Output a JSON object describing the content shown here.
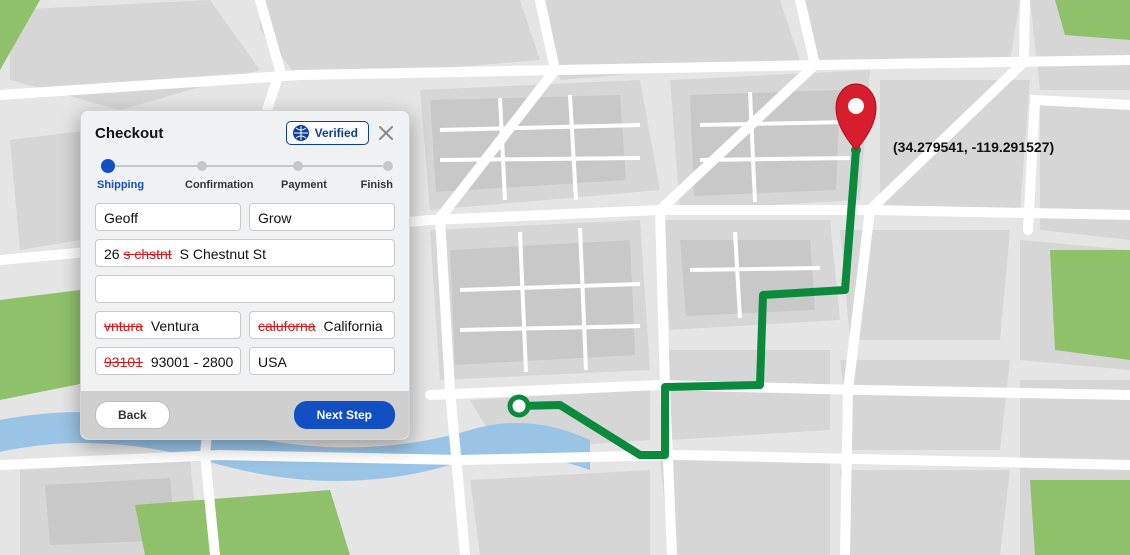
{
  "checkout": {
    "title": "Checkout",
    "verified_label": "Verified",
    "steps": {
      "shipping": "Shipping",
      "confirmation": "Confirmation",
      "payment": "Payment",
      "finish": "Finish",
      "active_index": 0
    },
    "form": {
      "first_name": "Geoff",
      "last_name": "Grow",
      "address1_prefix": "26",
      "address1_bad": "s chstnt",
      "address1_good": "S Chestnut St",
      "address2": "",
      "city_bad": "vntura",
      "city_good": "Ventura",
      "state_bad": "caluforna",
      "state_good": "California",
      "zip_bad": "93101",
      "zip_good": "93001 - 2800",
      "country": "USA"
    },
    "buttons": {
      "back": "Back",
      "next": "Next Step"
    }
  },
  "map": {
    "marker_coords": "(34.279541, -119.291527)",
    "route_color": "#0a8a3c",
    "marker_color": "#d81e2c",
    "water_color": "#99c4e6",
    "park_color": "#8fc06a"
  }
}
